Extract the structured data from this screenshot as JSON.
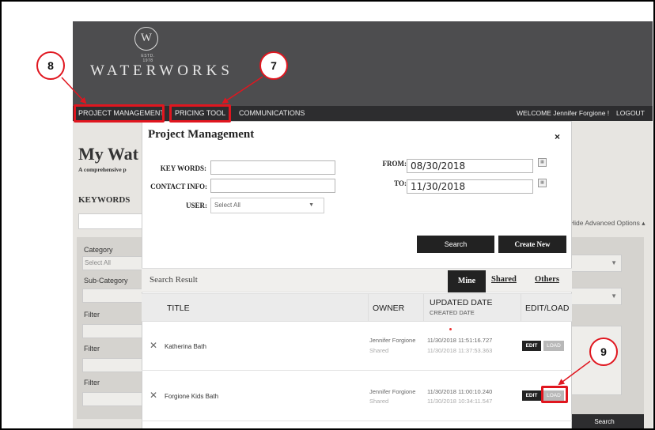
{
  "site": {
    "logo_glyph": "W",
    "logo_est": "ESTD. 1978",
    "logo_name": "WATERWORKS"
  },
  "nav": {
    "project_management": "PROJECT MANAGEMENT",
    "pricing_tool": "PRICING TOOL",
    "communications": "COMMUNICATIONS",
    "welcome": "WELCOME Jennifer Forgione !",
    "logout": "LOGOUT"
  },
  "page": {
    "title": "My Wat",
    "subtitle": "A comprehensive p",
    "keywords_label": "KEYWORDS",
    "hide_advanced": "Hide Advanced Options ▴",
    "bg_search": "Search",
    "left_panel": {
      "category_label": "Category",
      "category_value": "Select All",
      "subcategory_label": "Sub-Category",
      "filter1_label": "Filter",
      "filter2_label": "Filter",
      "filter3_label": "Filter"
    }
  },
  "modal": {
    "title": "Project Management",
    "close": "×",
    "key_words_label": "KEY WORDS:",
    "key_words_value": "",
    "contact_info_label": "CONTACT INFO:",
    "contact_info_value": "",
    "user_label": "USER:",
    "user_value": "Select All",
    "from_label": "FROM:",
    "from_value": "08/30/2018",
    "to_label": "TO:",
    "to_value": "11/30/2018",
    "search_button": "Search",
    "create_new_button": "Create New",
    "search_result_label": "Search Result",
    "tabs": {
      "mine": "Mine",
      "shared": "Shared",
      "others": "Others"
    },
    "columns": {
      "title": "TITLE",
      "owner": "OWNER",
      "updated_date": "UPDATED DATE",
      "created_date": "CREATED DATE",
      "edit_load": "EDIT/LOAD"
    },
    "rows": [
      {
        "title": "Katherina Bath",
        "owner": "Jennifer Forgione",
        "shared": "Shared",
        "updated": "11/30/2018 11:51:16.727",
        "created": "11/30/2018 11:37:53.363",
        "edit": "EDIT",
        "load": "LOAD"
      },
      {
        "title": "Forgione Kids Bath",
        "owner": "Jennifer Forgione",
        "shared": "Shared",
        "updated": "11/30/2018 11:00:10.240",
        "created": "11/30/2018 10:34:11.547",
        "edit": "EDIT",
        "load": "LOAD"
      }
    ]
  },
  "annotations": {
    "callout_8": "8",
    "callout_7": "7",
    "callout_9": "9",
    "color": "#e0161f"
  }
}
